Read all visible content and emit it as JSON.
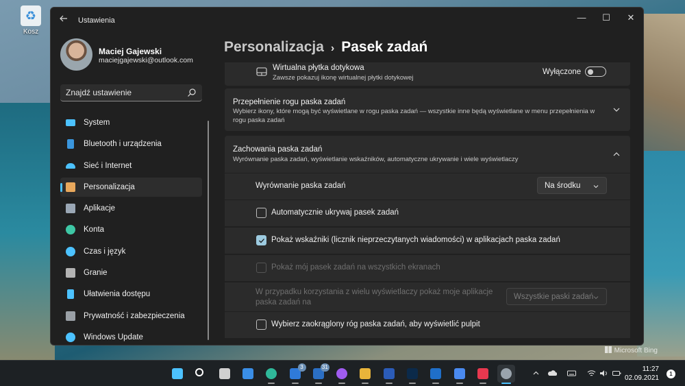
{
  "desktop": {
    "recycle_bin_label": "Kosz",
    "watermark": "Microsoft Bing"
  },
  "window": {
    "app_title": "Ustawienia",
    "controls": {
      "minimize": "—",
      "maximize": "☐",
      "close": "✕"
    }
  },
  "profile": {
    "name": "Maciej Gajewski",
    "email": "maciejgajewski@outlook.com"
  },
  "search": {
    "placeholder": "Znajdź ustawienie"
  },
  "sidebar": {
    "items": [
      {
        "label": "System",
        "icon": "monitor-icon",
        "color": "#4cc2ff"
      },
      {
        "label": "Bluetooth i urządzenia",
        "icon": "bluetooth-icon",
        "color": "#3a96dd"
      },
      {
        "label": "Sieć i Internet",
        "icon": "wifi-icon",
        "color": "#4cc2ff"
      },
      {
        "label": "Personalizacja",
        "icon": "brush-icon",
        "color": "#e8a85c"
      },
      {
        "label": "Aplikacje",
        "icon": "apps-icon",
        "color": "#9aa7b5"
      },
      {
        "label": "Konta",
        "icon": "person-icon",
        "color": "#3ec7a5"
      },
      {
        "label": "Czas i język",
        "icon": "clock-globe-icon",
        "color": "#4cc2ff"
      },
      {
        "label": "Granie",
        "icon": "gamepad-icon",
        "color": "#b3b3b3"
      },
      {
        "label": "Ułatwienia dostępu",
        "icon": "accessibility-icon",
        "color": "#4cc2ff"
      },
      {
        "label": "Prywatność i zabezpieczenia",
        "icon": "shield-icon",
        "color": "#9aa0a6"
      },
      {
        "label": "Windows Update",
        "icon": "update-icon",
        "color": "#4cc2ff"
      }
    ],
    "active_index": 3,
    "accent": "#4cc2ff"
  },
  "breadcrumb": {
    "parent": "Personalizacja",
    "separator": "›",
    "current": "Pasek zadań"
  },
  "touchpad": {
    "title": "Wirtualna płytka dotykowa",
    "desc": "Zawsze pokazuj ikonę wirtualnej płytki dotykowej",
    "toggle_label": "Wyłączone",
    "on": false
  },
  "overflow": {
    "title": "Przepełnienie rogu paska zadań",
    "desc_line1": "Wybierz ikony, które mogą być wyświetlane w rogu paska zadań — wszystkie inne będą wyświetlane w menu przepełnienia w",
    "desc_line2": "rogu paska zadań"
  },
  "behaviors": {
    "title": "Zachowania paska zadań",
    "desc": "Wyrównanie paska zadań, wyświetlanie wskaźników, automatyczne ukrywanie i wiele wyświetlaczy",
    "alignment_label": "Wyrównanie paska zadań",
    "alignment_value": "Na środku",
    "autohide_label": "Automatycznie ukrywaj pasek zadań",
    "autohide_checked": false,
    "badges_label": "Pokaż wskaźniki (licznik nieprzeczytanych wiadomości) w aplikacjach paska zadań",
    "badges_checked": true,
    "all_displays_label": "Pokaż mój pasek zadań na wszystkich ekranach",
    "all_displays_checked": false,
    "multi_label_line1": "W przypadku korzystania z wielu wyświetlaczy pokaż moje aplikacje",
    "multi_label_line2": "paska zadań na",
    "multi_value": "Wszystkie paski zadań",
    "corner_label": "Wybierz zaokrąglony róg paska zadań, aby wyświetlić pulpit",
    "corner_checked": false
  },
  "taskbar": {
    "apps": [
      {
        "name": "start-icon",
        "color": "#4cc2ff"
      },
      {
        "name": "search-icon",
        "color": "#ffffff"
      },
      {
        "name": "task-view-icon",
        "color": "#d0d0d0"
      },
      {
        "name": "widgets-icon",
        "color": "#3a8ee6"
      },
      {
        "name": "edge-icon",
        "color": "#2fb99a"
      },
      {
        "name": "mail-icon",
        "color": "#2f7ad9",
        "badge": "3"
      },
      {
        "name": "calendar-icon",
        "color": "#2b6fc4",
        "badge": "31"
      },
      {
        "name": "messenger-icon",
        "color": "#a05cf0"
      },
      {
        "name": "slack-icon",
        "color": "#e8b43a"
      },
      {
        "name": "word-icon",
        "color": "#2b5cb8"
      },
      {
        "name": "photoshop-icon",
        "color": "#0b2a4a"
      },
      {
        "name": "trello-icon",
        "color": "#1f6fc9"
      },
      {
        "name": "translate-icon",
        "color": "#4a8af0"
      },
      {
        "name": "creative-cloud-icon",
        "color": "#e8384f"
      },
      {
        "name": "settings-gear-icon",
        "color": "#9aa4ad"
      }
    ],
    "active_index": 14,
    "time": "11:27",
    "date": "02.09.2021",
    "notifications": "1"
  }
}
